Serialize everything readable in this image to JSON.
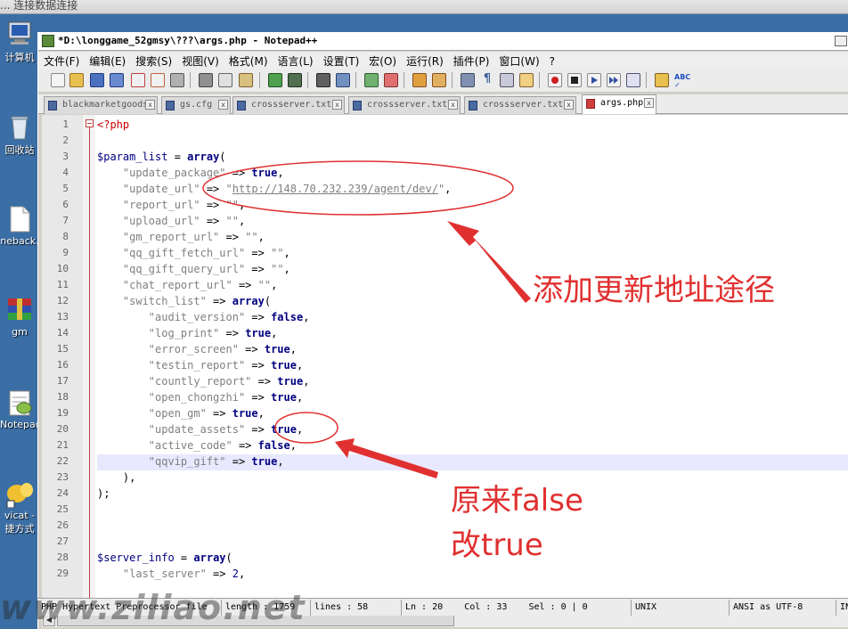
{
  "desktop": {
    "top_text": "... 连接数据连接",
    "icons": [
      {
        "label": "计算机"
      },
      {
        "label": "回收站"
      },
      {
        "label": "neback."
      },
      {
        "label": "gm"
      },
      {
        "label": "Notepad"
      },
      {
        "label": "vicat -"
      },
      {
        "label": "捷方式"
      }
    ]
  },
  "window": {
    "title": "*D:\\longgame_52gmsy\\???\\args.php - Notepad++"
  },
  "menu": {
    "items": [
      "文件(F)",
      "编辑(E)",
      "搜索(S)",
      "视图(V)",
      "格式(M)",
      "语言(L)",
      "设置(T)",
      "宏(O)",
      "运行(R)",
      "插件(P)",
      "窗口(W)",
      "?"
    ]
  },
  "tabs": [
    {
      "label": "blackmarketgoods"
    },
    {
      "label": "gs.cfg"
    },
    {
      "label": "crossserver.txt"
    },
    {
      "label": "crossserver.txt"
    },
    {
      "label": "crossserver.txt"
    },
    {
      "label": "args.php"
    }
  ],
  "editor": {
    "line_numbers": [
      "1",
      "2",
      "3",
      "4",
      "5",
      "6",
      "7",
      "8",
      "9",
      "10",
      "11",
      "12",
      "13",
      "14",
      "15",
      "16",
      "17",
      "18",
      "19",
      "20",
      "21",
      "22",
      "23",
      "24",
      "25",
      "26",
      "27",
      "28",
      "29"
    ],
    "php_open": "<?php",
    "param_var": "$param_list",
    "server_var": "$server_info",
    "assign": " = ",
    "arrow": " => ",
    "kw_array": "array",
    "kw_true": "true",
    "kw_false": "false",
    "l4_key": "\"update_package\"",
    "l5_key": "\"update_url\"",
    "l5_q": "\"",
    "l5_url": "http://148.70.232.239/agent/dev/",
    "l6_key": "\"report_url\"",
    "l7_key": "\"upload_url\"",
    "l8_key": "\"gm_report_url\"",
    "l9_key": "\"qq_gift_fetch_url\"",
    "l10_key": "\"qq_gift_query_url\"",
    "l11_key": "\"chat_report_url\"",
    "l12_key": "\"switch_list\"",
    "l13_key": "\"audit_version\"",
    "l14_key": "\"log_print\"",
    "l15_key": "\"error_screen\"",
    "l16_key": "\"testin_report\"",
    "l17_key": "\"countly_report\"",
    "l18_key": "\"open_chongzhi\"",
    "l19_key": "\"open_gm\"",
    "l20_key": "\"update_assets\"",
    "l21_key": "\"active_code\"",
    "l22_key": "\"qqvip_gift\"",
    "l29_key": "\"last_server\"",
    "l29_val": "2",
    "empty_str": "\"\"",
    "close_inner": "),",
    "close_outer": ");"
  },
  "status": {
    "type": "PHP Hypertext Preprocessor file",
    "length": "length : 1759",
    "lines": "lines : 58",
    "pos": "Ln : 20    Col : 33    Sel : 0 | 0",
    "eol": "UNIX",
    "encoding": "ANSI as UTF-8",
    "mode": "IN"
  },
  "annotations": {
    "note_url": "添加更新地址途径",
    "note_false_1": "原来false",
    "note_false_2": "改true",
    "color": "#e03030"
  },
  "watermark": "www.ziliao.net"
}
